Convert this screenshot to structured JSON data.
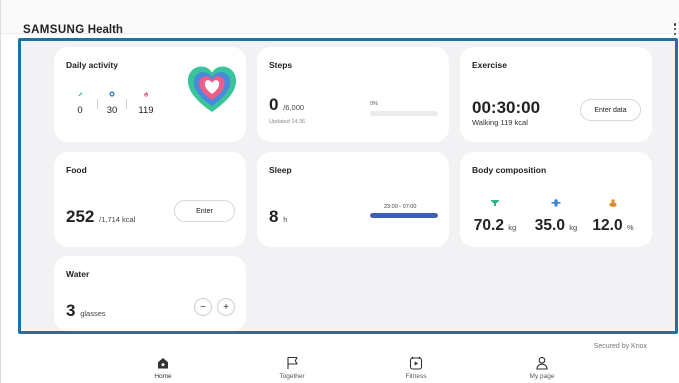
{
  "app": {
    "brand_samsung": "SAMSUNG",
    "brand_health": "Health"
  },
  "cards": {
    "daily_activity": {
      "title": "Daily activity",
      "values": [
        "0",
        "30",
        "119"
      ]
    },
    "steps": {
      "title": "Steps",
      "count": "0",
      "goal": "/6,000",
      "updated": "Updated 14:36",
      "percent_label": "0%",
      "progress": 0
    },
    "exercise": {
      "title": "Exercise",
      "duration": "00:30:00",
      "summary": "Walking 119 kcal",
      "button": "Enter data"
    },
    "food": {
      "title": "Food",
      "kcal": "252",
      "goal": "/1,714 kcal",
      "button": "Enter"
    },
    "sleep": {
      "title": "Sleep",
      "hours": "8",
      "unit": "h",
      "range": "23:00 - 07:00",
      "progress": 1
    },
    "body": {
      "title": "Body composition",
      "metrics": [
        {
          "value": "70.2",
          "unit": "kg",
          "color": "#2bb58a"
        },
        {
          "value": "35.0",
          "unit": "kg",
          "color": "#3b82d6"
        },
        {
          "value": "12.0",
          "unit": "%",
          "color": "#e08a2c"
        }
      ]
    },
    "water": {
      "title": "Water",
      "count": "3",
      "unit": "glasses",
      "minus": "−",
      "plus": "+"
    }
  },
  "footer": {
    "secured": "Secured by Knox"
  },
  "nav": {
    "items": [
      {
        "label": "Home",
        "icon": "home-icon"
      },
      {
        "label": "Together",
        "icon": "flag-icon"
      },
      {
        "label": "Fitness",
        "icon": "play-screen-icon"
      },
      {
        "label": "My page",
        "icon": "person-icon"
      }
    ]
  },
  "colors": {
    "accent": "#3d5fb0",
    "highlight_border": "#1f6fa8",
    "background": "#f2f2f4"
  }
}
